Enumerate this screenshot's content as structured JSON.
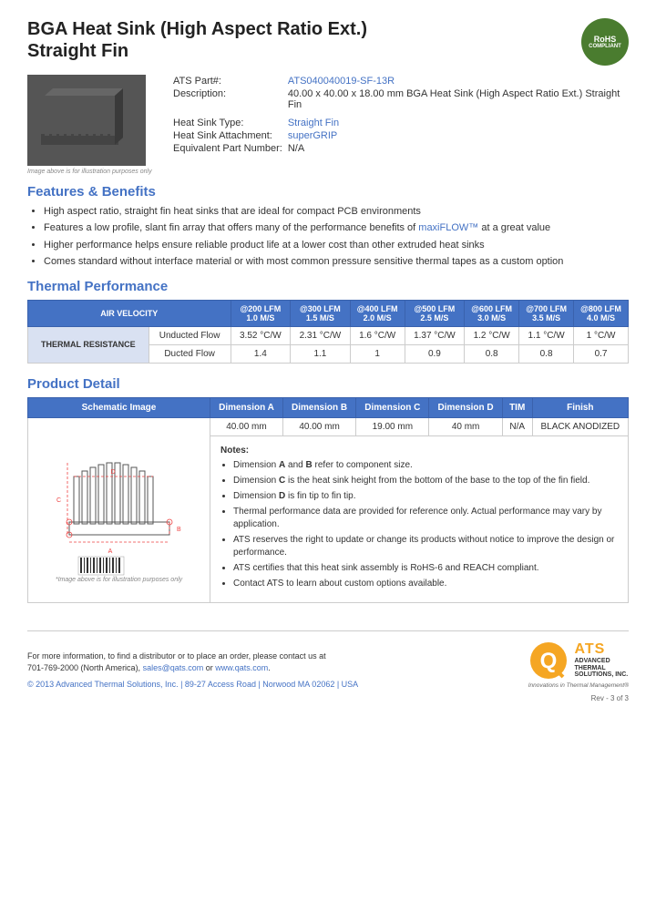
{
  "header": {
    "title_line1": "BGA Heat Sink (High Aspect Ratio Ext.)",
    "title_line2": "Straight Fin",
    "rohs": "RoHS\nCOMPLIANT"
  },
  "specs": {
    "part_label": "ATS Part#:",
    "part_value": "ATS040040019-SF-13R",
    "desc_label": "Description:",
    "desc_value": "40.00 x 40.00 x 18.00 mm  BGA Heat Sink (High Aspect Ratio Ext.) Straight Fin",
    "type_label": "Heat Sink Type:",
    "type_value": "Straight Fin",
    "attachment_label": "Heat Sink Attachment:",
    "attachment_value": "superGRIP",
    "equiv_label": "Equivalent Part Number:",
    "equiv_value": "N/A"
  },
  "image_caption": "Image above is for illustration purposes only",
  "features": {
    "section_title": "Features & Benefits",
    "items": [
      "High aspect ratio, straight fin heat sinks that are ideal for compact PCB environments",
      "Features a low profile, slant fin array that offers many of the performance benefits of maxiFLOW™ at a great value",
      "Higher performance helps ensure reliable product life at a lower cost than other extruded heat sinks",
      "Comes standard without interface material or with most common pressure sensitive thermal tapes as a custom option"
    ],
    "highlight_word": "maxiFLOW™"
  },
  "thermal": {
    "section_title": "Thermal Performance",
    "col_headers": [
      "AIR VELOCITY",
      "@200 LFM\n1.0 M/S",
      "@300 LFM\n1.5 M/S",
      "@400 LFM\n2.0 M/S",
      "@500 LFM\n2.5 M/S",
      "@600 LFM\n3.0 M/S",
      "@700 LFM\n3.5 M/S",
      "@800 LFM\n4.0 M/S"
    ],
    "row_header": "THERMAL RESISTANCE",
    "rows": [
      {
        "label": "Unducted Flow",
        "values": [
          "3.52 °C/W",
          "2.31 °C/W",
          "1.6 °C/W",
          "1.37 °C/W",
          "1.2 °C/W",
          "1.1 °C/W",
          "1 °C/W"
        ]
      },
      {
        "label": "Ducted Flow",
        "values": [
          "1.4",
          "1.1",
          "1",
          "0.9",
          "0.8",
          "0.8",
          "0.7"
        ]
      }
    ]
  },
  "product_detail": {
    "section_title": "Product Detail",
    "table_headers": [
      "Schematic Image",
      "Dimension A",
      "Dimension B",
      "Dimension C",
      "Dimension D",
      "TIM",
      "Finish"
    ],
    "dimension_values": [
      "40.00 mm",
      "40.00 mm",
      "19.00 mm",
      "40 mm",
      "N/A",
      "BLACK ANODIZED"
    ],
    "schematic_caption": "*Image above is for illustration purposes only",
    "notes_title": "Notes:",
    "notes": [
      "Dimension A and B refer to component size.",
      "Dimension C is the heat sink height from the bottom of the base to the top of the fin field.",
      "Dimension D is fin tip to fin tip.",
      "Thermal performance data are provided for reference only. Actual performance may vary by application.",
      "ATS reserves the right to update or change its products without notice to improve the design or performance.",
      "ATS certifies that this heat sink assembly is RoHS-6 and REACH compliant.",
      "Contact ATS to learn about custom options available."
    ]
  },
  "footer": {
    "contact_text": "For more information, to find a distributor or to place an order, please contact us at\n701-769-2000 (North America),",
    "email": "sales@qats.com",
    "website": "www.qats.com",
    "copyright": "© 2013 Advanced Thermal Solutions, Inc.  |  89-27 Access Road  |  Norwood MA  02062  |  USA",
    "page_num": "Rev - 3 of 3",
    "ats_name": "ATS",
    "ats_fullname": "ADVANCED\nTHERMAL\nSOLUTIONS, INC.",
    "ats_tagline": "Innovations in Thermal Management®"
  }
}
